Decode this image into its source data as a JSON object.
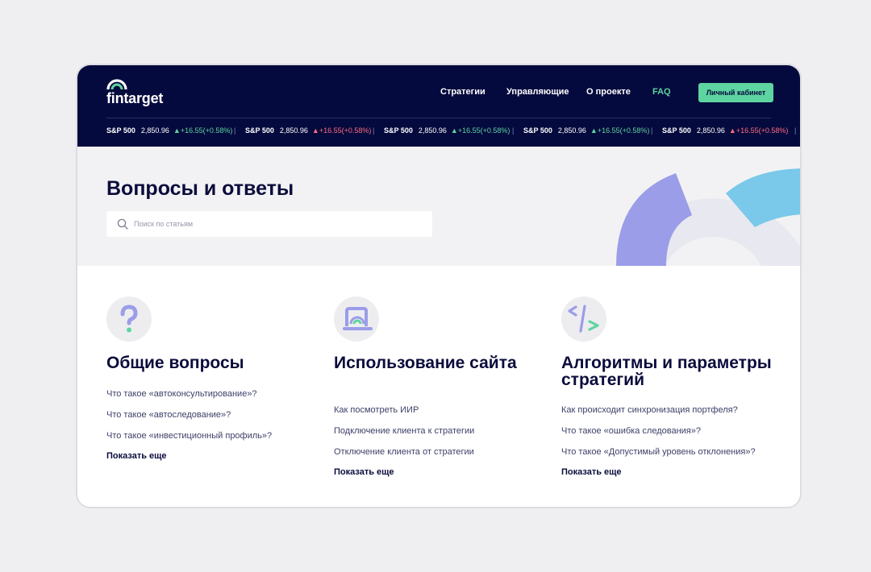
{
  "brand": {
    "name": "fintarget"
  },
  "nav": {
    "items": [
      "Стратегии",
      "Управляющие",
      "О проекте",
      "FAQ"
    ],
    "cabinet_label": "Личный кабинет"
  },
  "ticker": [
    {
      "name": "S&P 500",
      "price": "2,850.96",
      "change": "▲+16.55(+0.58%)",
      "dir": "up"
    },
    {
      "name": "S&P 500",
      "price": "2,850.96",
      "change": "▲+16.55(+0.58%)",
      "dir": "down"
    },
    {
      "name": "S&P 500",
      "price": "2,850.96",
      "change": "▲+16.55(+0.58%)",
      "dir": "up"
    },
    {
      "name": "S&P 500",
      "price": "2,850.96",
      "change": "▲+16.55(+0.58%)",
      "dir": "up"
    },
    {
      "name": "S&P 500",
      "price": "2,850.96",
      "change": "▲+16.55(+0.58%)",
      "dir": "down"
    }
  ],
  "hero": {
    "title": "Вопросы и ответы",
    "search_placeholder": "Поиск по статьям"
  },
  "categories": [
    {
      "icon": "question-icon",
      "title": "Общие вопросы",
      "links": [
        "Что такое «автоконсультирование»?",
        "Что такое «автоследование»?",
        "Что такое «инвестиционный профиль»?"
      ],
      "more": "Показать еще"
    },
    {
      "icon": "laptop-icon",
      "title": "Использование сайта",
      "links": [
        "Как посмотреть ИИР",
        "Подключение клиента к стратегии",
        "Отключение клиента от стратегии"
      ],
      "more": "Показать еще"
    },
    {
      "icon": "code-icon",
      "title": "Алгоритмы и параметры стратегий",
      "links": [
        "Как происходит синхронизация портфеля?",
        "Что такое «ошибка следования»?",
        "Что такое «Допустимый уровень отклонения»?"
      ],
      "more": "Показать еще"
    }
  ],
  "colors": {
    "header": "#050a3e",
    "accent": "#5ed4a0",
    "purple": "#9b9de8",
    "blue": "#7ac8ea"
  }
}
